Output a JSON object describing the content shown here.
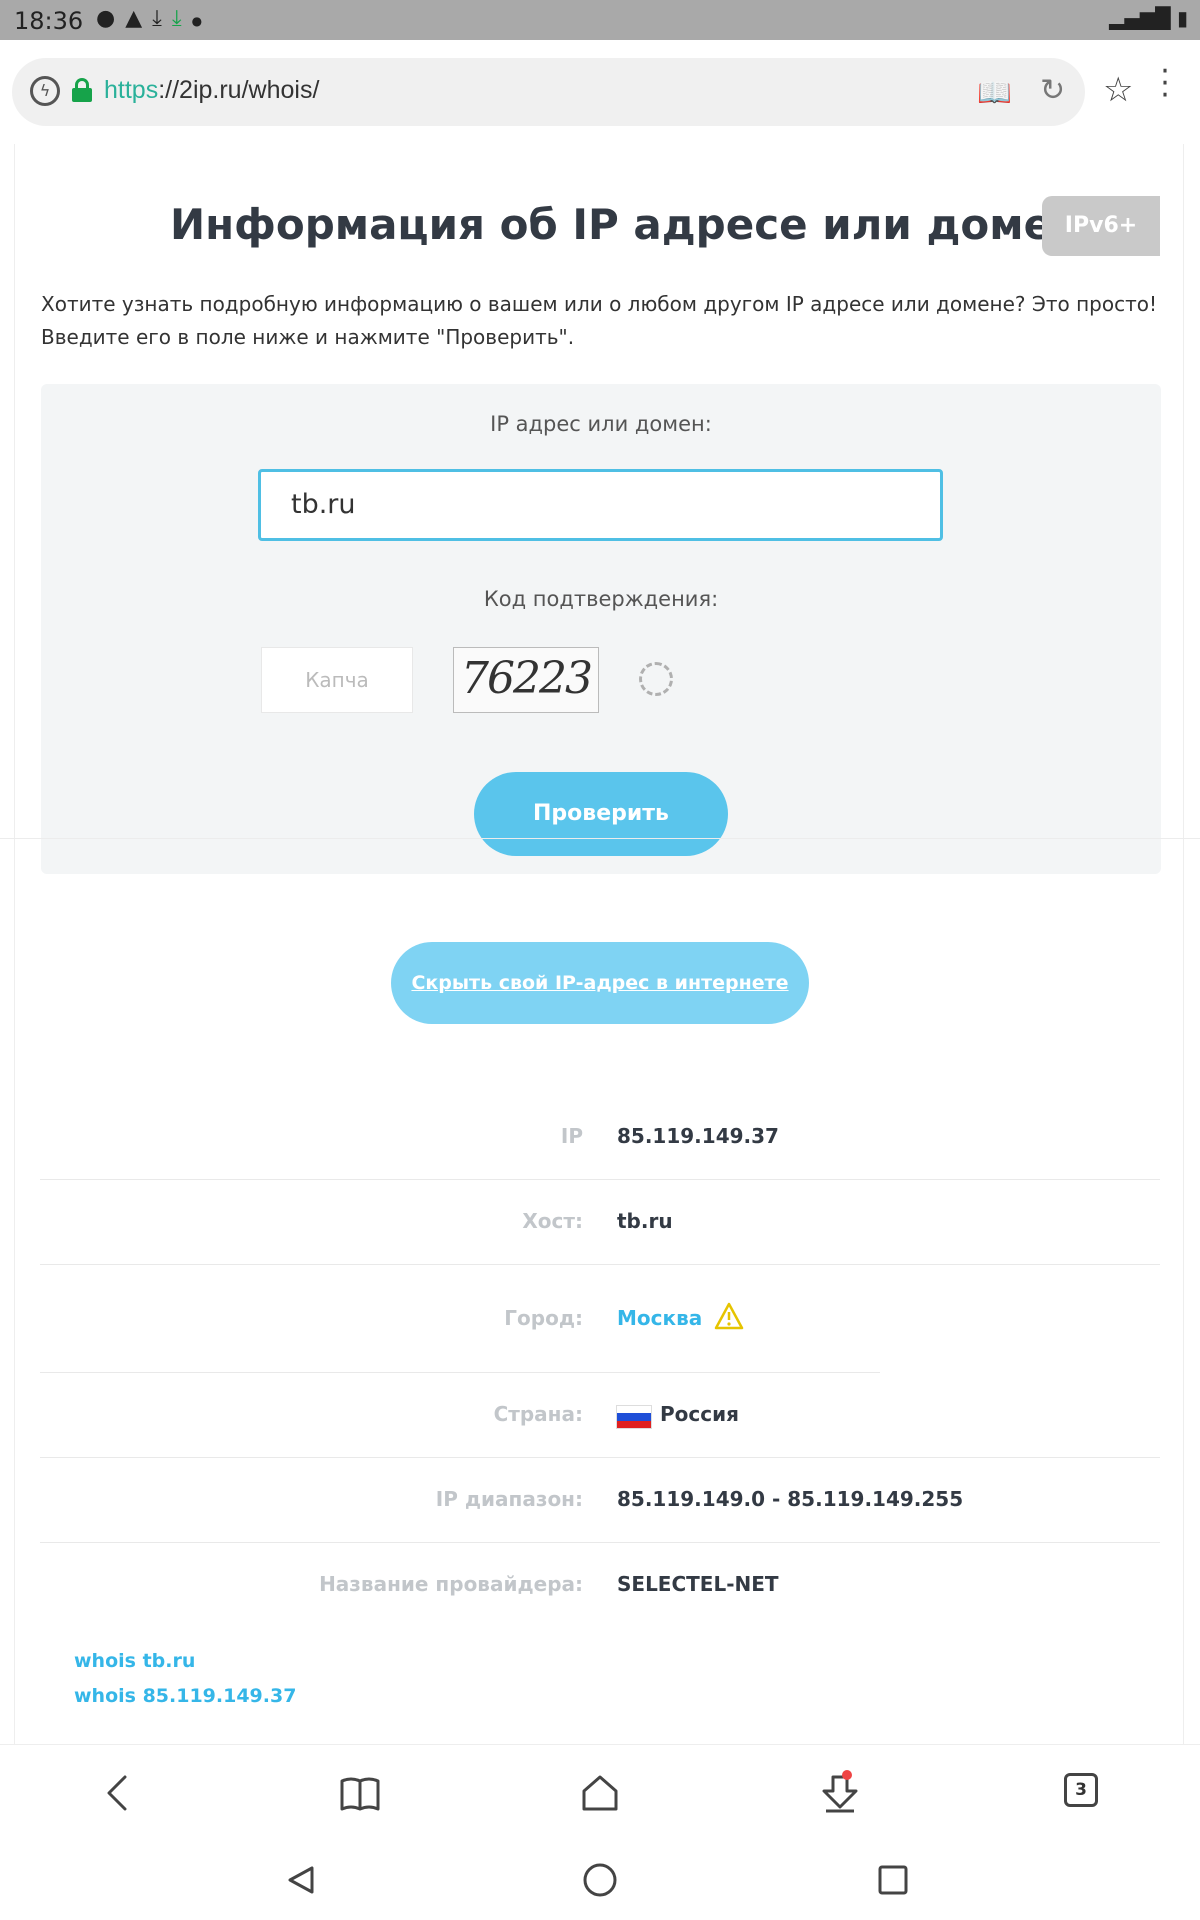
{
  "status_bar": {
    "time": "18:36",
    "notification_icons": [
      "chat-icon",
      "warning-icon",
      "download-icon",
      "download-done-icon",
      "dot-icon"
    ],
    "right_icons": [
      "signal-icon",
      "battery-icon"
    ]
  },
  "browser": {
    "url_scheme": "https",
    "url_rest": "://2ip.ru/whois/",
    "icons": [
      "lightning-icon",
      "lock-icon",
      "reader-mode-icon",
      "reload-icon",
      "star-icon",
      "menu-icon"
    ]
  },
  "page": {
    "title": "Информация об IP адресе или домене",
    "ipv6_badge": "IPv6+",
    "intro_line1": "Хотите узнать подробную информацию о вашем или о любом другом IP адресе или домене? Это просто!",
    "intro_line2": "Введите его в поле ниже и нажмите \"Проверить\".",
    "form": {
      "ip_label": "IP адрес или домен:",
      "ip_value": "tb.ru",
      "code_label": "Код подтверждения:",
      "captcha_placeholder": "Капча",
      "captcha_text": "76223",
      "check_button": "Проверить"
    },
    "hide_ip_button": "Скрыть свой IP-адрес в интернете",
    "info": [
      {
        "label": "IP",
        "value": "85.119.149.37"
      },
      {
        "label": "Хост:",
        "value": "tb.ru"
      },
      {
        "label": "Город:",
        "value": "Москва"
      },
      {
        "label": "Страна:",
        "value": "Россия"
      },
      {
        "label": "IP диапазон:",
        "value": "85.119.149.0 - 85.119.149.255"
      },
      {
        "label": "Название провайдера:",
        "value": "SELECTEL-NET"
      }
    ],
    "whois_links": [
      "whois tb.ru",
      "whois 85.119.149.37"
    ]
  },
  "bottom_nav": {
    "tabs_count": "3",
    "icons": [
      "back-icon",
      "bookmarks-icon",
      "home-icon",
      "downloads-icon",
      "tabs-icon"
    ]
  },
  "colors": {
    "accent": "#5ac5ec",
    "link": "#35b6e8",
    "secure": "#16a34a"
  }
}
